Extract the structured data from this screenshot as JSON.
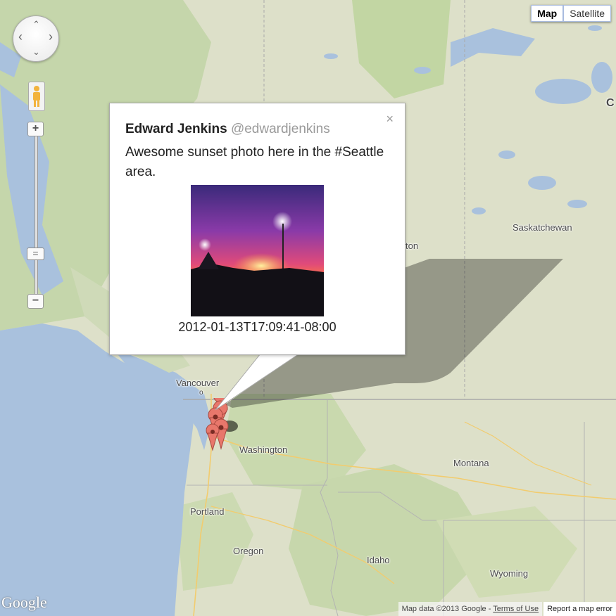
{
  "map_type": {
    "map_label": "Map",
    "satellite_label": "Satellite",
    "active": "Map"
  },
  "places": {
    "vancouver": "Vancouver",
    "washington": "Washington",
    "montana": "Montana",
    "portland": "Portland",
    "oregon": "Oregon",
    "idaho": "Idaho",
    "wyoming": "Wyoming",
    "saskatchewan": "Saskatchewan",
    "partial_ton": "ton",
    "partial_c": "C"
  },
  "controls": {
    "zoom_in": "+",
    "zoom_out": "−",
    "zoom_thumb": "=",
    "pan_up": "⌃",
    "pan_down": "⌄",
    "pan_left": "‹",
    "pan_right": "›"
  },
  "info_window": {
    "name": "Edward Jenkins",
    "handle": "@edwardjenkins",
    "text": "Awesome sunset photo here in the #Seattle area.",
    "timestamp": "2012-01-13T17:09:41-08:00",
    "close_label": "×"
  },
  "branding": {
    "logo": "Google"
  },
  "attribution": {
    "map_data": "Map data ©2013 Google -",
    "terms": "Terms of Use",
    "report": "Report a map error"
  },
  "colors": {
    "land": "#d9dcc4",
    "water": "#a5bfdd",
    "marker": "#e8776b",
    "forest": "#b9cf9b"
  }
}
